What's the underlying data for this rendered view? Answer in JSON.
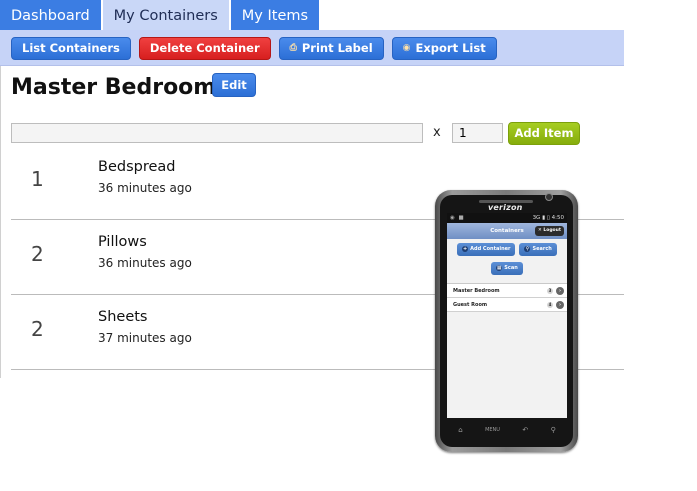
{
  "tabs": [
    {
      "label": "Dashboard",
      "active": false
    },
    {
      "label": "My Containers",
      "active": true
    },
    {
      "label": "My Items",
      "active": false
    }
  ],
  "toolbar": {
    "list_containers": "List Containers",
    "delete_container": "Delete Container",
    "print_label": "Print Label",
    "export_list": "Export List"
  },
  "container": {
    "title": "Master Bedroom",
    "edit_label": "Edit"
  },
  "add_item": {
    "item_value": "",
    "times_label": "x",
    "quantity_value": "1",
    "button_label": "Add Item"
  },
  "items": [
    {
      "qty": "1",
      "name": "Bedspread",
      "time": "36 minutes ago"
    },
    {
      "qty": "2",
      "name": "Pillows",
      "time": "36 minutes ago"
    },
    {
      "qty": "2",
      "name": "Sheets",
      "time": "37 minutes ago"
    }
  ],
  "phone": {
    "brand": "verizon",
    "status_time": "4:50",
    "status_network": "3G",
    "header_title": "Containers",
    "logout_label": "Logout",
    "add_container_label": "Add Container",
    "search_label": "Search",
    "scan_label": "Scan",
    "list": [
      {
        "name": "Master Bedroom",
        "count": "3"
      },
      {
        "name": "Guest Room",
        "count": "4"
      }
    ],
    "nav_menu_label": "MENU"
  },
  "colors": {
    "tab_blue": "#3b7de3",
    "toolbar_bg": "#c6d3f7",
    "danger_red": "#d71f1f",
    "add_green": "#86ad0c"
  }
}
